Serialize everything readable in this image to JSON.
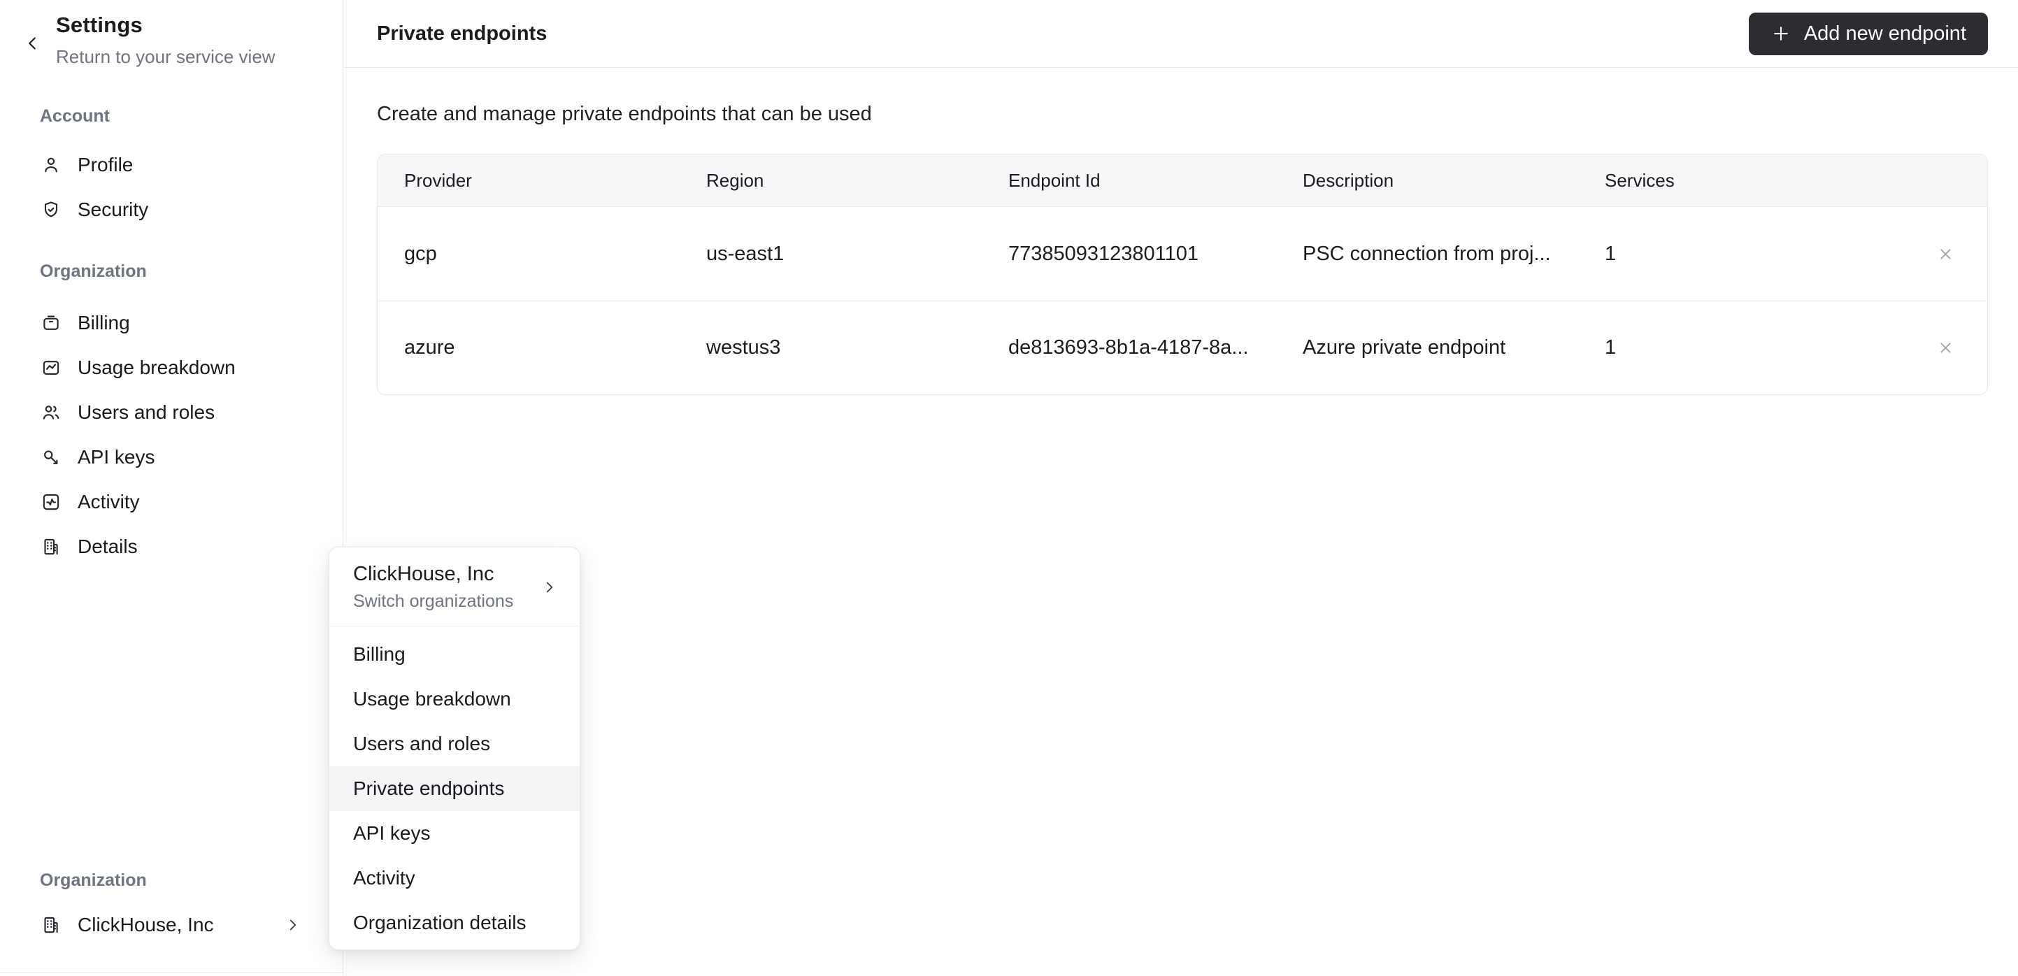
{
  "sidebar": {
    "title": "Settings",
    "subtitle": "Return to your service view",
    "back_icon": "chevron-left-icon",
    "sections": [
      {
        "label": "Account",
        "items": [
          {
            "label": "Profile",
            "icon": "user-icon"
          },
          {
            "label": "Security",
            "icon": "shield-check-icon"
          }
        ]
      },
      {
        "label": "Organization",
        "items": [
          {
            "label": "Billing",
            "icon": "wallet-icon"
          },
          {
            "label": "Usage breakdown",
            "icon": "chart-frame-icon"
          },
          {
            "label": "Users and roles",
            "icon": "users-icon"
          },
          {
            "label": "API keys",
            "icon": "key-icon"
          },
          {
            "label": "Activity",
            "icon": "activity-icon"
          },
          {
            "label": "Details",
            "icon": "building-icon"
          }
        ]
      }
    ],
    "footer": {
      "label": "Organization",
      "org_name": "ClickHouse, Inc",
      "icon": "building-icon",
      "chevron": "chevron-right-icon"
    }
  },
  "header": {
    "title": "Private endpoints",
    "add_button_label": "Add new endpoint",
    "add_button_icon": "plus-icon"
  },
  "main": {
    "intro": "Create and manage private endpoints that can be used"
  },
  "table": {
    "columns": [
      "Provider",
      "Region",
      "Endpoint Id",
      "Description",
      "Services"
    ],
    "rows": [
      {
        "provider": "gcp",
        "region": "us-east1",
        "endpoint_id": "77385093123801101",
        "description": "PSC connection from proj...",
        "services": "1",
        "action_icon": "close-icon"
      },
      {
        "provider": "azure",
        "region": "westus3",
        "endpoint_id": "de813693-8b1a-4187-8a...",
        "description": "Azure private endpoint",
        "services": "1",
        "action_icon": "close-icon"
      }
    ]
  },
  "popup": {
    "org_name": "ClickHouse, Inc",
    "org_subtitle": "Switch organizations",
    "chevron": "chevron-right-icon",
    "items": [
      "Billing",
      "Usage breakdown",
      "Users and roles",
      "Private endpoints",
      "API keys",
      "Activity",
      "Organization details"
    ],
    "active_item": "Private endpoints"
  },
  "colors": {
    "button_bg": "#2b2d31",
    "border": "#e6e8ea",
    "muted_text": "#6e7481",
    "table_header_bg": "#f6f7f9",
    "highlight_bg": "#f4f5f7",
    "close_icon": "#9aa0a8"
  }
}
